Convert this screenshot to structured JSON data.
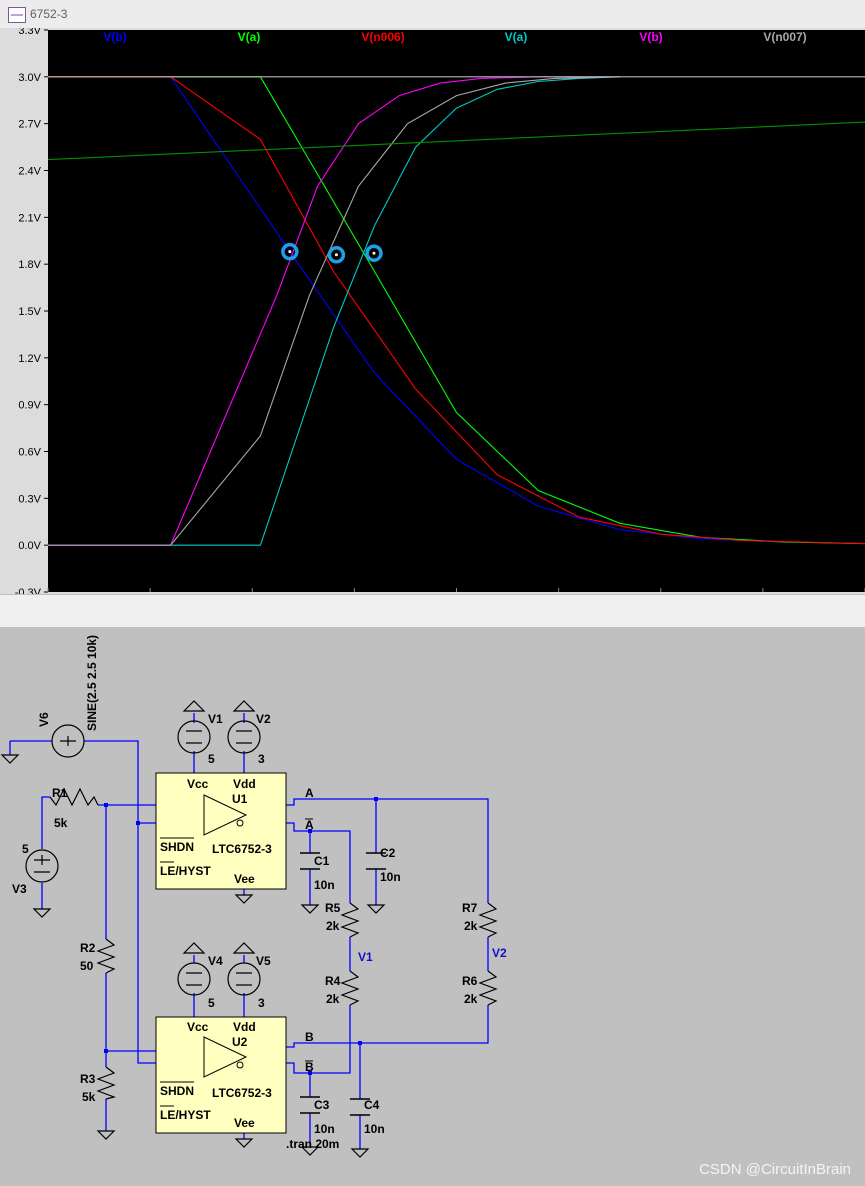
{
  "window": {
    "title": "6752-3"
  },
  "chart_data": {
    "type": "line",
    "ylim": [
      -0.3,
      3.3
    ],
    "yticks": [
      3.3,
      3.0,
      2.7,
      2.4,
      2.1,
      1.8,
      1.5,
      1.2,
      0.9,
      0.6,
      0.3,
      0.0,
      -0.3
    ],
    "ytick_labels": [
      "3.3V",
      "3.0V",
      "2.7V",
      "2.4V",
      "2.1V",
      "1.8V",
      "1.5V",
      "1.2V",
      "0.9V",
      "0.6V",
      "0.3V",
      "0.0V",
      "-0.3V"
    ],
    "xlim": [
      0,
      100
    ],
    "xticks": [
      0,
      12.5,
      25,
      37.5,
      50,
      62.5,
      75,
      87.5,
      100
    ],
    "grid": false,
    "legend_position": "top",
    "series": [
      {
        "name": "V(b)",
        "color": "#0000ff",
        "x": [
          0,
          15,
          30,
          40,
          50,
          60,
          70,
          80,
          90,
          100
        ],
        "y": [
          3.0,
          3.0,
          1.85,
          1.1,
          0.55,
          0.25,
          0.1,
          0.04,
          0.02,
          0.01
        ]
      },
      {
        "name": "V(a)",
        "color": "#00ff00",
        "x": [
          0,
          15,
          26,
          40,
          50,
          60,
          70,
          80,
          90,
          100
        ],
        "y": [
          3.0,
          3.0,
          3.0,
          1.75,
          0.85,
          0.35,
          0.14,
          0.05,
          0.02,
          0.01
        ]
      },
      {
        "name": "V(n006)",
        "color": "#ff0000",
        "x": [
          0,
          15,
          26,
          35,
          45,
          55,
          65,
          75,
          85,
          100
        ],
        "y": [
          3.0,
          3.0,
          2.6,
          1.75,
          1.0,
          0.45,
          0.18,
          0.07,
          0.03,
          0.01
        ]
      },
      {
        "name": "V(a)",
        "color": "#00c8c8",
        "x": [
          0,
          26,
          35,
          40,
          45,
          50,
          55,
          60,
          65,
          70
        ],
        "y": [
          0.0,
          0.0,
          1.4,
          2.05,
          2.55,
          2.8,
          2.92,
          2.97,
          2.99,
          3.0
        ]
      },
      {
        "name": "V(b)",
        "color": "#ff00ff",
        "x": [
          0,
          15,
          28,
          33,
          38,
          43,
          48,
          53,
          60,
          70
        ],
        "y": [
          0.0,
          0.0,
          1.6,
          2.3,
          2.7,
          2.88,
          2.96,
          2.99,
          3.0,
          3.0
        ]
      },
      {
        "name": "V(n007)",
        "color": "#a8a8a8",
        "x": [
          0,
          15,
          26,
          32,
          38,
          44,
          50,
          56,
          62,
          70
        ],
        "y": [
          0.0,
          0.0,
          0.7,
          1.6,
          2.3,
          2.7,
          2.88,
          2.96,
          2.99,
          3.0
        ]
      },
      {
        "name": "V(v2)",
        "color": "#009000",
        "x": [
          0,
          100
        ],
        "y": [
          2.47,
          2.71
        ]
      },
      {
        "name": "V(v1)",
        "color": "#b8b8b8",
        "x": [
          0,
          100
        ],
        "y": [
          3.0,
          3.0
        ]
      }
    ],
    "markers": [
      {
        "x": 29.6,
        "y": 1.88
      },
      {
        "x": 35.3,
        "y": 1.86
      },
      {
        "x": 39.9,
        "y": 1.87
      }
    ],
    "legend": [
      {
        "label": "V(b)",
        "color": "#0000ff"
      },
      {
        "label": "V(a)",
        "color": "#00ff00"
      },
      {
        "label": "V(n006)",
        "color": "#ff0000"
      },
      {
        "label": "V(a)",
        "color": "#00c8c8"
      },
      {
        "label": "V(b)",
        "color": "#ff00ff"
      },
      {
        "label": "V(n007)",
        "color": "#a8a8a8"
      }
    ]
  },
  "schematic": {
    "sources": {
      "v6": {
        "name": "V6",
        "value": "SINE(2.5 2.5 10k)"
      },
      "v1": {
        "name": "V1",
        "value": "5"
      },
      "v2": {
        "name": "V2",
        "value": "3"
      },
      "v3": {
        "name": "V3",
        "value": "5"
      },
      "v4": {
        "name": "V4",
        "value": "5"
      },
      "v5": {
        "name": "V5",
        "value": "3"
      }
    },
    "resistors": {
      "r1": {
        "name": "R1",
        "value": "5k"
      },
      "r2": {
        "name": "R2",
        "value": "50"
      },
      "r3": {
        "name": "R3",
        "value": "5k"
      },
      "r4": {
        "name": "R4",
        "value": "2k"
      },
      "r5": {
        "name": "R5",
        "value": "2k"
      },
      "r6": {
        "name": "R6",
        "value": "2k"
      },
      "r7": {
        "name": "R7",
        "value": "2k"
      }
    },
    "capacitors": {
      "c1": {
        "name": "C1",
        "value": "10n"
      },
      "c2": {
        "name": "C2",
        "value": "10n"
      },
      "c3": {
        "name": "C3",
        "value": "10n"
      },
      "c4": {
        "name": "C4",
        "value": "10n"
      }
    },
    "ics": {
      "u1": {
        "name": "U1",
        "part": "LTC6752-3",
        "vcc": "Vcc",
        "vdd": "Vdd",
        "vee": "Vee",
        "shdn": "SHDN",
        "le": "LE/HYST"
      },
      "u2": {
        "name": "U2",
        "part": "LTC6752-3",
        "vcc": "Vcc",
        "vdd": "Vdd",
        "vee": "Vee",
        "shdn": "SHDN",
        "le": "LE/HYST"
      }
    },
    "nets": {
      "a": "A",
      "abar": "A",
      "b": "B",
      "bbar": "B",
      "v1": "V1",
      "v2": "V2"
    },
    "directive": ".tran 20m"
  },
  "watermark": "CSDN @CircuitInBrain"
}
